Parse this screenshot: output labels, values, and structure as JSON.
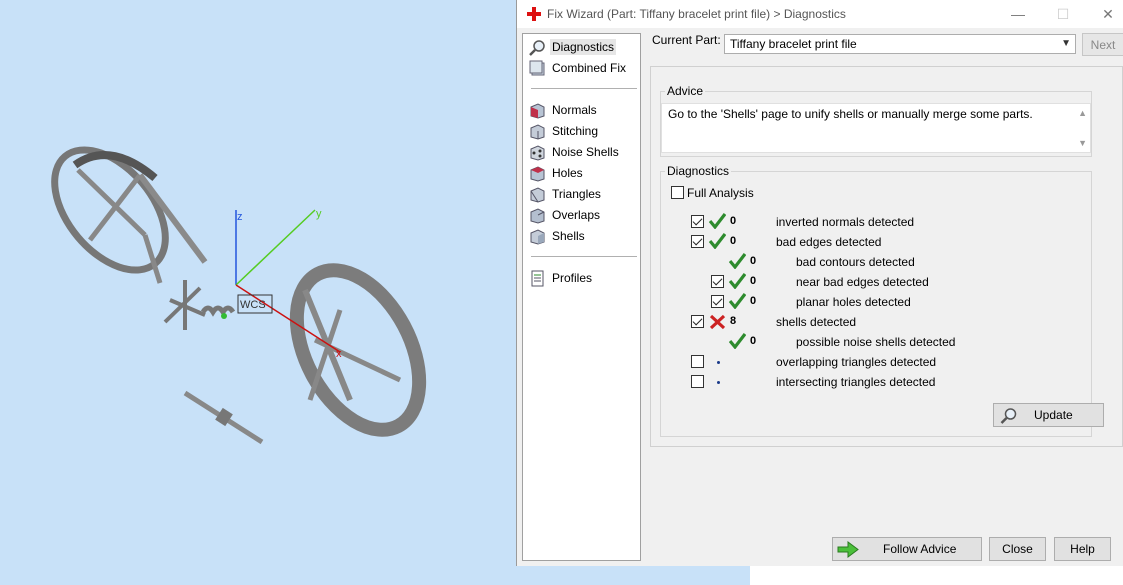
{
  "dialog": {
    "title": "Fix Wizard (Part: Tiffany bracelet print file) > Diagnostics",
    "window_buttons": [
      "—",
      "☐",
      "✕"
    ]
  },
  "nav": {
    "items": [
      {
        "label": "Diagnostics",
        "icon": "magnifier-icon",
        "selected": true
      },
      {
        "label": "Combined Fix",
        "icon": "combined-fix-icon"
      },
      {
        "label": "Normals",
        "icon": "normals-cube-icon"
      },
      {
        "label": "Stitching",
        "icon": "stitching-cube-icon"
      },
      {
        "label": "Noise Shells",
        "icon": "noise-shells-icon"
      },
      {
        "label": "Holes",
        "icon": "holes-cube-icon"
      },
      {
        "label": "Triangles",
        "icon": "triangles-cube-icon"
      },
      {
        "label": "Overlaps",
        "icon": "overlaps-cube-icon"
      },
      {
        "label": "Shells",
        "icon": "shells-cube-icon"
      },
      {
        "label": "Profiles",
        "icon": "document-icon"
      }
    ]
  },
  "part": {
    "label": "Current Part:",
    "value": "Tiffany bracelet print file",
    "next_label": "Next"
  },
  "advice": {
    "title": "Advice",
    "text": "Go to the 'Shells' page to unify shells or manually merge some parts."
  },
  "diagnostics": {
    "title": "Diagnostics",
    "full_analysis_label": "Full Analysis",
    "rows": [
      {
        "checkbox": true,
        "checked": true,
        "status": "ok",
        "count": "0",
        "label": "inverted normals detected",
        "indent": 0
      },
      {
        "checkbox": true,
        "checked": true,
        "status": "ok",
        "count": "0",
        "label": "bad edges detected",
        "indent": 0
      },
      {
        "checkbox": false,
        "checked": false,
        "status": "ok",
        "count": "0",
        "label": "bad contours detected",
        "indent": 1
      },
      {
        "checkbox": true,
        "checked": true,
        "status": "ok",
        "count": "0",
        "label": "near bad edges detected",
        "indent": 1
      },
      {
        "checkbox": true,
        "checked": true,
        "status": "ok",
        "count": "0",
        "label": "planar holes detected",
        "indent": 1
      },
      {
        "checkbox": true,
        "checked": true,
        "status": "error",
        "count": "8",
        "label": "shells detected",
        "indent": 0
      },
      {
        "checkbox": false,
        "checked": false,
        "status": "ok",
        "count": "0",
        "label": "possible noise shells detected",
        "indent": 1
      },
      {
        "checkbox": true,
        "checked": false,
        "status": "pending",
        "count": "",
        "label": "overlapping triangles detected",
        "indent": 0
      },
      {
        "checkbox": true,
        "checked": false,
        "status": "pending",
        "count": "",
        "label": "intersecting triangles detected",
        "indent": 0
      }
    ],
    "update_label": "Update"
  },
  "footer": {
    "follow_advice_label": "Follow Advice",
    "close_label": "Close",
    "help_label": "Help"
  },
  "viewport": {
    "axis_labels": {
      "x": "x",
      "y": "y",
      "z": "z"
    },
    "wcs_label": "WCS"
  },
  "colors": {
    "viewport_bg": "#c8e1f8",
    "ok_green": "#2e8b2e",
    "error_red": "#cc2222",
    "axis_x": "#cc1111",
    "axis_y": "#55cc22",
    "axis_z": "#2255dd"
  }
}
